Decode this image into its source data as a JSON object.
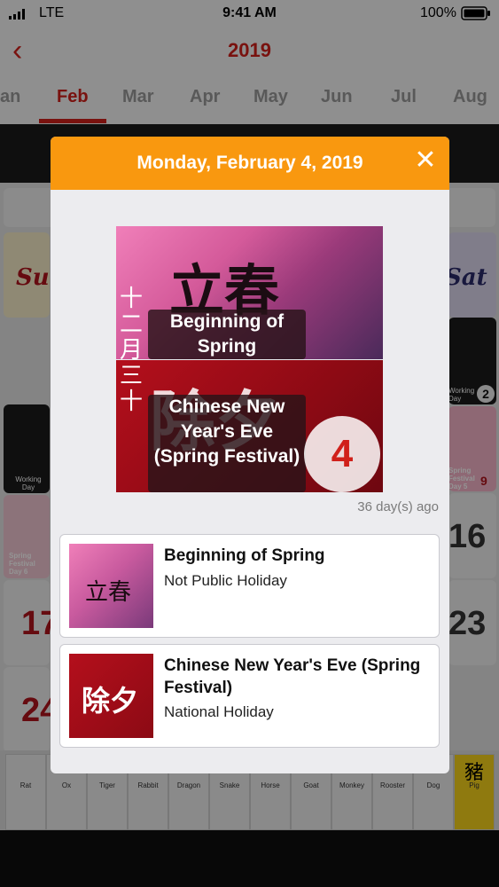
{
  "status": {
    "carrier": "LTE",
    "time": "9:41 AM",
    "battery": "100%"
  },
  "header": {
    "back_glyph": "‹",
    "year": "2019"
  },
  "months": [
    "an",
    "Feb",
    "Mar",
    "Apr",
    "May",
    "Jun",
    "Jul",
    "Aug"
  ],
  "calendar_background": {
    "sun_label": "Sun",
    "sat_label": "Sat",
    "working_day_label": "Working Day",
    "working_day_2_num": "2",
    "spring_festival_day5": "Spring Festival Day 5",
    "spring_festival_day5_num": "9",
    "spring_festival_day6": "Spring Festival Day 6",
    "day_16": "16",
    "day_17": "17",
    "day_23": "23",
    "day_24": "24",
    "zodiac": [
      "Rat",
      "Ox",
      "Tiger",
      "Rabbit",
      "Dragon",
      "Snake",
      "Horse",
      "Goat",
      "Monkey",
      "Rooster",
      "Dog",
      "Pig"
    ],
    "pig_char": "豬"
  },
  "modal": {
    "title": "Monday, February 4, 2019",
    "close_glyph": "✕",
    "hero": {
      "lunar_date": "十二月三十",
      "top_chars": "立春",
      "label_top": "Beginning of Spring",
      "bottom_chars": "除夕",
      "label_bottom": "Chinese New Year's Eve (Spring Festival)",
      "day_number": "4"
    },
    "ago": "36 day(s) ago",
    "events": [
      {
        "title": "Beginning of Spring",
        "subtitle": "Not Public Holiday",
        "thumb_chars": "立春"
      },
      {
        "title": "Chinese New Year's Eve (Spring Festival)",
        "subtitle": "National Holiday",
        "thumb_chars": "除夕"
      }
    ]
  },
  "colors": {
    "accent_red": "#d0201a",
    "modal_header_orange": "#f9980f"
  }
}
